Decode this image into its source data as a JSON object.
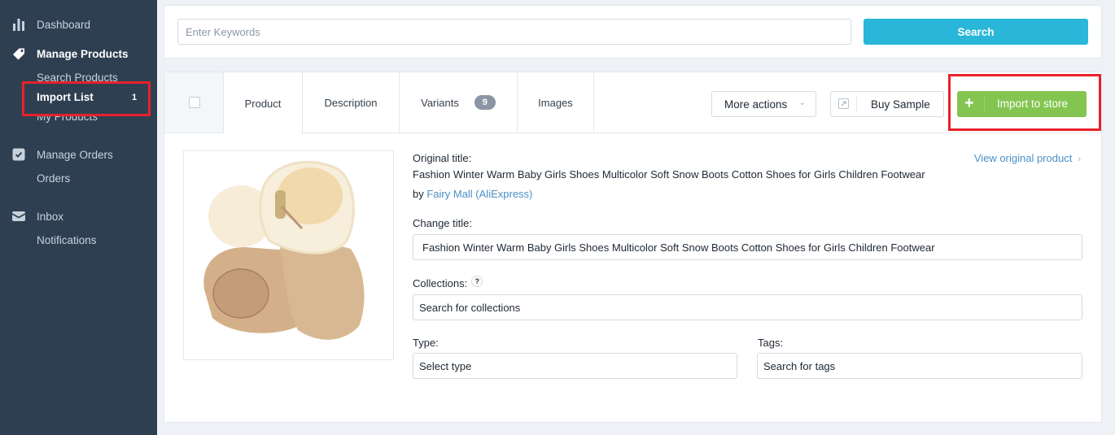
{
  "sidebar": {
    "dashboard": {
      "label": "Dashboard",
      "icon": "bar-chart-icon"
    },
    "manage_products": {
      "label": "Manage Products",
      "icon": "tag-icon",
      "items": [
        {
          "label": "Search Products"
        },
        {
          "label": "Import List",
          "count": "1",
          "active": true
        },
        {
          "label": "My Products"
        }
      ]
    },
    "manage_orders": {
      "label": "Manage Orders",
      "icon": "checkbox-icon",
      "items": [
        {
          "label": "Orders"
        }
      ]
    },
    "inbox": {
      "label": "Inbox",
      "icon": "envelope-icon",
      "items": [
        {
          "label": "Notifications"
        }
      ]
    }
  },
  "search": {
    "placeholder": "Enter Keywords",
    "button": "Search"
  },
  "tabs": [
    {
      "label": "Product",
      "active": true
    },
    {
      "label": "Description"
    },
    {
      "label": "Variants",
      "badge": "9"
    },
    {
      "label": "Images"
    }
  ],
  "actions": {
    "more_actions": "More actions",
    "buy_sample": "Buy Sample",
    "import_to_store": "Import to store"
  },
  "product": {
    "image_alt": "Baby winter snow boots",
    "original_title_label": "Original title:",
    "original_title": "Fashion Winter Warm Baby Girls Shoes Multicolor Soft Snow Boots Cotton Shoes for Girls Children Footwear",
    "by_label": "by",
    "seller": "Fairy Mall (AliExpress)",
    "view_original": "View original product",
    "change_title_label": "Change title:",
    "change_title_value": "Fashion Winter Warm Baby Girls Shoes Multicolor Soft Snow Boots Cotton Shoes for Girls Children Footwear",
    "collections_label": "Collections:",
    "collections_help": "?",
    "collections_placeholder": "Search for collections",
    "type_label": "Type:",
    "type_placeholder": "Select type",
    "tags_label": "Tags:",
    "tags_placeholder": "Search for tags"
  },
  "colors": {
    "sidebar_bg": "#2e3f52",
    "search_button": "#29b6d8",
    "import_button": "#84c551",
    "link": "#4a90c6",
    "highlight": "#e8212a"
  }
}
